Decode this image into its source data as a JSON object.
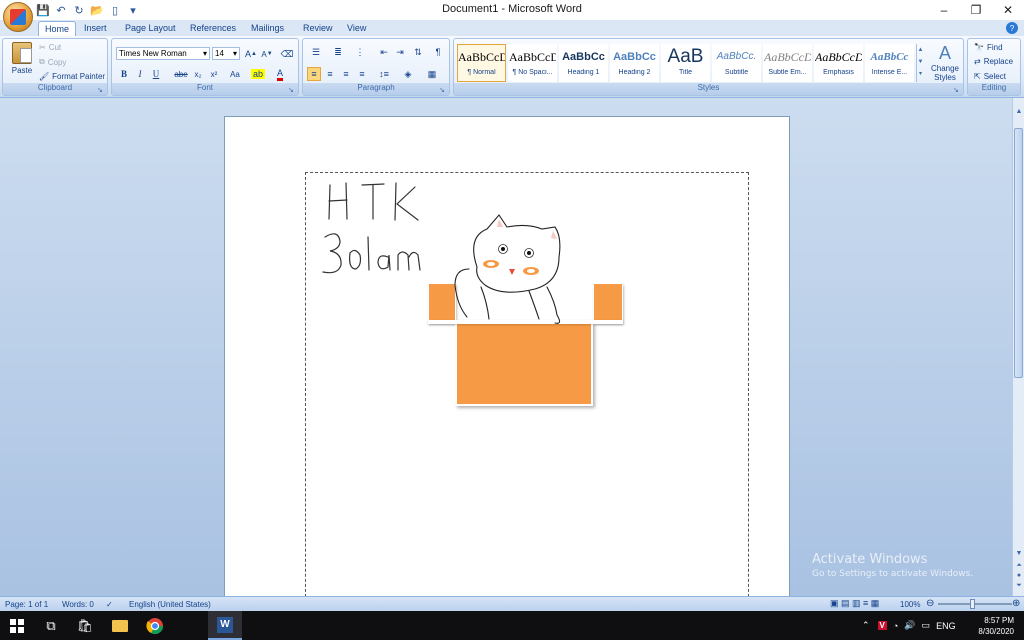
{
  "window": {
    "title": "Document1 - Microsoft Word",
    "controls": {
      "minimize": "–",
      "maximize": "❐",
      "close": "✕"
    }
  },
  "tabs": [
    "Home",
    "Insert",
    "Page Layout",
    "References",
    "Mailings",
    "Review",
    "View"
  ],
  "clipboard": {
    "paste": "Paste",
    "cut": "Cut",
    "copy": "Copy",
    "format_painter": "Format Painter",
    "label": "Clipboard"
  },
  "font": {
    "family": "Times New Roman",
    "size": "14",
    "label": "Font",
    "buttons": [
      "B",
      "I",
      "U",
      "abe",
      "x₂",
      "x²",
      "Aa"
    ]
  },
  "paragraph": {
    "label": "Paragraph"
  },
  "styles": {
    "label": "Styles",
    "items": [
      {
        "sample": "AaBbCcDc",
        "name": "¶ Normal"
      },
      {
        "sample": "AaBbCcDc",
        "name": "¶ No Spaci..."
      },
      {
        "sample": "AaBbCc",
        "name": "Heading 1"
      },
      {
        "sample": "AaBbCc",
        "name": "Heading 2"
      },
      {
        "sample": "AaB",
        "name": "Title"
      },
      {
        "sample": "AaBbCc.",
        "name": "Subtitle"
      },
      {
        "sample": "AaBbCcDc",
        "name": "Subtle Em..."
      },
      {
        "sample": "AaBbCcDc",
        "name": "Emphasis"
      },
      {
        "sample": "AaBbCc",
        "name": "Intense E..."
      }
    ],
    "change_styles": "Change Styles"
  },
  "editing": {
    "find": "Find",
    "replace": "Replace",
    "select": "Select",
    "label": "Editing"
  },
  "document": {
    "handwriting_line1": "HTK",
    "handwriting_line2": "3olam"
  },
  "activation": {
    "line1": "Activate Windows",
    "line2": "Go to Settings to activate Windows."
  },
  "status": {
    "page": "Page: 1 of 1",
    "words": "Words: 0",
    "language": "English (United States)",
    "zoom": "100%"
  },
  "taskbar": {
    "language": "ENG",
    "time": "8:57 PM",
    "date": "8/30/2020"
  },
  "colors": {
    "orange": "#f79a45",
    "ribbon_blue": "#15428b"
  }
}
